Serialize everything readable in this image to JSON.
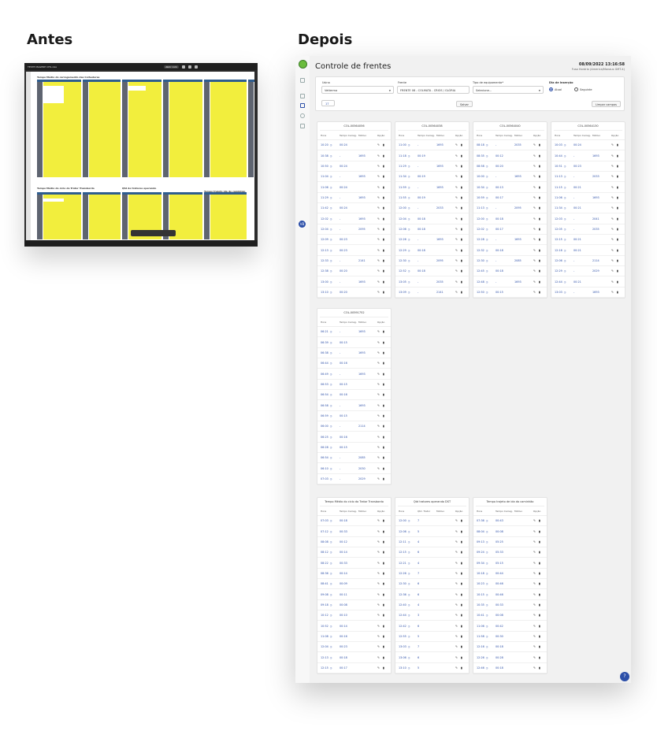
{
  "headings": {
    "before": "Antes",
    "after": "Depois"
  },
  "screenshot": {
    "file_title": "TESTE MAGERE CHS.xlsx",
    "share_button": "Abrir com",
    "block_titles": [
      "Tempo Médio do carregamento das Colhedoras",
      "Tempo Médio do ciclo do Trator Transbordo",
      "Qtd de tratores operando",
      "Tempo trajeto ida do caminhão"
    ]
  },
  "app": {
    "title": "Controle de frentes",
    "datetime": "08/09/2022 13:16:58",
    "timezone": "Fuso Horário (America/Manaus GMT-4)",
    "filters": {
      "usina_label": "Usina",
      "usina_value": "Vetterma",
      "frente_label": "Frente",
      "frente_value": "FRENTE 08 - COLMATA - CRIOS / GLÓRIA",
      "tipo_label": "Tipo de equipamento*",
      "tipo_value": "Selecione...",
      "dia_label": "Dia de inserção",
      "radio_atual": "Atual",
      "radio_seguinte": "Seguinte",
      "tag": "17",
      "save_button": "Salvar",
      "clear_button": "Limpar campos"
    },
    "help_label": "?",
    "cards": [
      {
        "title": "COL-00564056",
        "columns": [
          "Hora",
          "Tempo Carreg.",
          "Motivo",
          "Opção"
        ],
        "rows": [
          [
            "10:20",
            "00:24",
            ""
          ],
          [
            "10:38",
            "-",
            "1693"
          ],
          [
            "10:50",
            "00:24",
            ""
          ],
          [
            "11:04",
            "-",
            "1693"
          ],
          [
            "11:06",
            "00:24",
            ""
          ],
          [
            "11:29",
            "-",
            "1693"
          ],
          [
            "11:42",
            "00:24",
            ""
          ],
          [
            "12:02",
            "-",
            "1693"
          ],
          [
            "12:04",
            "-",
            "2095"
          ],
          [
            "12:09",
            "00:23",
            ""
          ],
          [
            "12:13",
            "00:23",
            ""
          ],
          [
            "12:33",
            "-",
            "2141"
          ],
          [
            "12:38",
            "00:20",
            ""
          ],
          [
            "13:00",
            "-",
            "1693"
          ],
          [
            "13:10",
            "00:20",
            ""
          ]
        ]
      },
      {
        "title": "COL-00564038",
        "columns": [
          "Hora",
          "Tempo Carreg.",
          "Motivo",
          "Opção"
        ],
        "rows": [
          [
            "11:00",
            "-",
            "1693"
          ],
          [
            "11:18",
            "00:19",
            ""
          ],
          [
            "11:29",
            "-",
            "1693"
          ],
          [
            "11:34",
            "00:19",
            ""
          ],
          [
            "11:59",
            "-",
            "1693"
          ],
          [
            "11:55",
            "00:19",
            ""
          ],
          [
            "12:00",
            "-",
            "2033"
          ],
          [
            "12:04",
            "00:18",
            ""
          ],
          [
            "12:06",
            "00:18",
            ""
          ],
          [
            "12:26",
            "-",
            "1693"
          ],
          [
            "12:29",
            "00:18",
            ""
          ],
          [
            "12:30",
            "-",
            "2095"
          ],
          [
            "12:52",
            "00:18",
            ""
          ],
          [
            "13:05",
            "-",
            "2035"
          ],
          [
            "13:09",
            "-",
            "2141"
          ]
        ]
      },
      {
        "title": "COL-00564040",
        "columns": [
          "Hora",
          "Tempo Carreg.",
          "Motivo",
          "Opção"
        ],
        "rows": [
          [
            "08:18",
            "-",
            "2035"
          ],
          [
            "08:35",
            "00:12",
            ""
          ],
          [
            "08:58",
            "00:20",
            ""
          ],
          [
            "10:00",
            "-",
            "1693"
          ],
          [
            "10:34",
            "00:13",
            ""
          ],
          [
            "10:59",
            "00:17",
            ""
          ],
          [
            "11:13",
            "-",
            "2095"
          ],
          [
            "12:00",
            "00:18",
            ""
          ],
          [
            "12:02",
            "00:17",
            ""
          ],
          [
            "12:28",
            "-",
            "1693"
          ],
          [
            "12:32",
            "00:18",
            ""
          ],
          [
            "12:30",
            "-",
            "2085"
          ],
          [
            "12:45",
            "00:18",
            ""
          ],
          [
            "12:48",
            "-",
            "1693"
          ],
          [
            "12:50",
            "00:15",
            ""
          ]
        ]
      },
      {
        "title": "COL-00564130",
        "columns": [
          "Hora",
          "Tempo Carreg.",
          "Motivo",
          "Opção"
        ],
        "rows": [
          [
            "10:03",
            "00:24",
            ""
          ],
          [
            "10:44",
            "-",
            "1693"
          ],
          [
            "10:51",
            "00:23",
            ""
          ],
          [
            "11:13",
            "-",
            "2033"
          ],
          [
            "11:15",
            "00:21",
            ""
          ],
          [
            "11:06",
            "-",
            "1693"
          ],
          [
            "11:34",
            "00:21",
            ""
          ],
          [
            "12:03",
            "-",
            "2041"
          ],
          [
            "12:05",
            "-",
            "2035"
          ],
          [
            "12:15",
            "00:21",
            ""
          ],
          [
            "12:16",
            "00:21",
            ""
          ],
          [
            "12:06",
            "-",
            "2114"
          ],
          [
            "12:29",
            "-",
            "2029"
          ],
          [
            "12:44",
            "00:21",
            ""
          ],
          [
            "13:03",
            "-",
            "1693"
          ]
        ]
      },
      {
        "title": "COL-00591752",
        "columns": [
          "Hora",
          "Tempo Carreg.",
          "Motivo",
          "Opção"
        ],
        "rows": [
          [
            "06:21",
            "-",
            "1693"
          ],
          [
            "06:39",
            "00:15",
            ""
          ],
          [
            "06:38",
            "-",
            "1693"
          ],
          [
            "06:44",
            "00:16",
            ""
          ],
          [
            "06:49",
            "-",
            "1693"
          ],
          [
            "06:53",
            "00:15",
            ""
          ],
          [
            "06:54",
            "00:16",
            ""
          ],
          [
            "06:58",
            "-",
            "1693"
          ],
          [
            "06:59",
            "00:15",
            ""
          ],
          [
            "06:00",
            "-",
            "2114"
          ],
          [
            "06:25",
            "00:16",
            ""
          ],
          [
            "06:28",
            "00:15",
            ""
          ],
          [
            "06:54",
            "-",
            "2085"
          ],
          [
            "06:10",
            "-",
            "2030"
          ],
          [
            "07:03",
            "-",
            "2029"
          ]
        ]
      },
      {
        "title": "Tempo Médio do ciclo do Trator Transbordo",
        "columns": [
          "Hora",
          "Tempo Carreg.",
          "Motivo",
          "Opção"
        ],
        "rows": [
          [
            "07:03",
            "00:18",
            ""
          ],
          [
            "07:12",
            "00:33",
            ""
          ],
          [
            "08:08",
            "00:12",
            ""
          ],
          [
            "08:12",
            "00:14",
            ""
          ],
          [
            "08:22",
            "00:33",
            ""
          ],
          [
            "08:36",
            "00:14",
            ""
          ],
          [
            "08:41",
            "00:09",
            ""
          ],
          [
            "09:08",
            "00:11",
            ""
          ],
          [
            "09:18",
            "00:08",
            ""
          ],
          [
            "10:12",
            "00:10",
            ""
          ],
          [
            "10:52",
            "00:14",
            ""
          ],
          [
            "11:08",
            "00:16",
            ""
          ],
          [
            "12:04",
            "00:23",
            ""
          ],
          [
            "12:13",
            "00:18",
            ""
          ],
          [
            "12:15",
            "00:17",
            ""
          ]
        ]
      },
      {
        "title": "Qtd tratores operando DST",
        "columns": [
          "Hora",
          "Qtd. Trator",
          "Motivo",
          "Opção"
        ],
        "rows": [
          [
            "12:00",
            "7",
            ""
          ],
          [
            "12:06",
            "5",
            ""
          ],
          [
            "12:11",
            "4",
            ""
          ],
          [
            "12:15",
            "6",
            ""
          ],
          [
            "12:21",
            "4",
            ""
          ],
          [
            "12:26",
            "7",
            ""
          ],
          [
            "12:30",
            "6",
            ""
          ],
          [
            "12:36",
            "6",
            ""
          ],
          [
            "12:40",
            "4",
            ""
          ],
          [
            "12:44",
            "3",
            ""
          ],
          [
            "12:42",
            "6",
            ""
          ],
          [
            "12:55",
            "5",
            ""
          ],
          [
            "13:03",
            "7",
            ""
          ],
          [
            "13:06",
            "6",
            ""
          ],
          [
            "13:10",
            "5",
            ""
          ]
        ]
      },
      {
        "title": "Tempo trajeto de ida do caminhão",
        "columns": [
          "Hora",
          "Tempo Carreg.",
          "Motivo",
          "Opção"
        ],
        "rows": [
          [
            "07:36",
            "00:43",
            ""
          ],
          [
            "08:04",
            "00:08",
            ""
          ],
          [
            "09:13",
            "05:25",
            ""
          ],
          [
            "09:24",
            "05:33",
            ""
          ],
          [
            "09:34",
            "05:15",
            ""
          ],
          [
            "10:18",
            "00:44",
            ""
          ],
          [
            "10:23",
            "00:46",
            ""
          ],
          [
            "10:15",
            "00:46",
            ""
          ],
          [
            "10:35",
            "00:33",
            ""
          ],
          [
            "10:41",
            "00:08",
            ""
          ],
          [
            "11:06",
            "00:42",
            ""
          ],
          [
            "11:58",
            "00:30",
            ""
          ],
          [
            "12:16",
            "00:18",
            ""
          ],
          [
            "12:26",
            "00:28",
            ""
          ],
          [
            "12:46",
            "00:18",
            ""
          ]
        ]
      }
    ]
  }
}
